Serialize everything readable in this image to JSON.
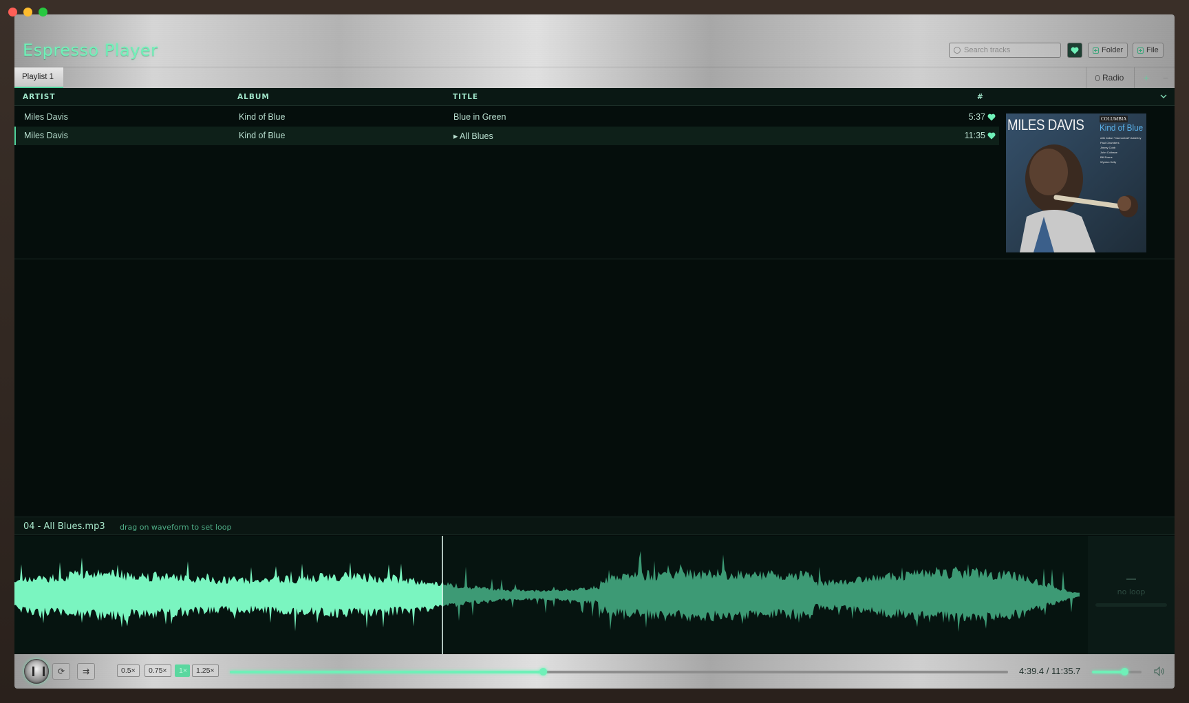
{
  "app": {
    "title": "Espresso Player"
  },
  "header": {
    "search_placeholder": "Search tracks",
    "folder_label": "Folder",
    "file_label": "File",
    "icons": {
      "search": "search-icon",
      "favorites": "heart-icon",
      "add": "plus-icon"
    }
  },
  "tabs": [
    {
      "label": "Playlist 1",
      "active": true
    }
  ],
  "radio": {
    "label": "Radio"
  },
  "table": {
    "headers": {
      "artist": "ARTIST",
      "album": "ALBUM",
      "title": "TITLE",
      "num": "#"
    },
    "rows": [
      {
        "artist": "Miles Davis",
        "album": "Kind of Blue",
        "title": "Blue in Green",
        "duration": "5:37",
        "favorite": true,
        "playing": false
      },
      {
        "artist": "Miles Davis",
        "album": "Kind of Blue",
        "title": "▸ All Blues",
        "duration": "11:35",
        "favorite": true,
        "playing": true
      }
    ]
  },
  "album_art": {
    "artist_text": "MILES DAVIS",
    "label_text": "COLUMBIA",
    "album_text": "Kind of Blue",
    "credits": [
      "with Julian \"Cannonball\" Adderley",
      "Paul Chambers",
      "Jimmy Cobb",
      "John Coltrane",
      "Bill Evans",
      "Wynton Kelly"
    ]
  },
  "waveform": {
    "file_name": "04 - All Blues.mp3",
    "hint": "drag on waveform to set loop",
    "loop_status": "no loop",
    "played_fraction": 0.402
  },
  "transport": {
    "speeds": [
      "0.5×",
      "0.75×",
      "1×",
      "1.25×"
    ],
    "active_speed": "1×",
    "time_display": "4:39.4 / 11:35.7",
    "progress": 0.402,
    "volume": 0.65,
    "icons": {
      "play": "pause-icon",
      "repeat": "repeat-icon",
      "shuffle": "shuffle-icon",
      "volume": "speaker-icon"
    }
  },
  "colors": {
    "accent": "#6ff0b8",
    "background": "#050d0b",
    "played_wave": "#7af5c0",
    "unplayed_wave": "#3d9a75"
  }
}
